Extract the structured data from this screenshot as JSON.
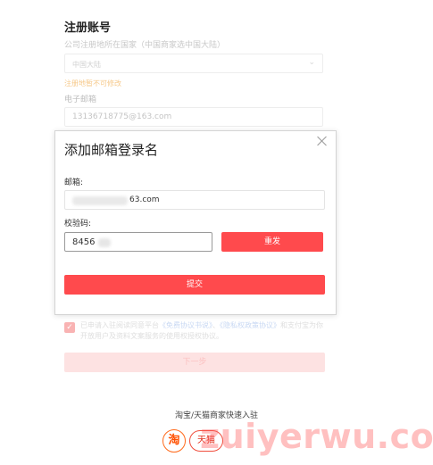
{
  "background": {
    "title": "注册账号",
    "country_label": "公司注册地所在国家（中国商家选中国大陆）",
    "country_value": "中国大陆",
    "country_tip": "注册地暂不可修改",
    "email_label": "电子邮箱",
    "email_value": "13136718775@163.com",
    "agree_text": "已申请入驻阅读同意平台",
    "agree_link_1": "《免费协议书说》",
    "agree_sep": "、",
    "agree_link_2": "《隐私权政策协议》",
    "agree_tail": "和支付宝为你开放用户及资料文案服务的使用权授权协议。",
    "next_button": "下一步",
    "quick_entry": "淘宝/天猫商家快速入驻",
    "logo_taobao": "淘",
    "logo_tmall": "天猫",
    "watermark": "zuiyerwu.com"
  },
  "modal": {
    "title": "添加邮箱登录名",
    "email_label": "邮箱:",
    "email_value_visible": "63.com",
    "code_label": "校验码:",
    "code_value_visible": "8456",
    "resend_button": "重发",
    "submit_button": "提交"
  },
  "colors": {
    "primary_red": "#ff4a4d",
    "taobao_orange": "#ff5000",
    "tmall_red": "#e0301e"
  },
  "icons": {
    "close": "close-icon",
    "chevron": "chevron-down-icon",
    "check": "check-icon"
  }
}
